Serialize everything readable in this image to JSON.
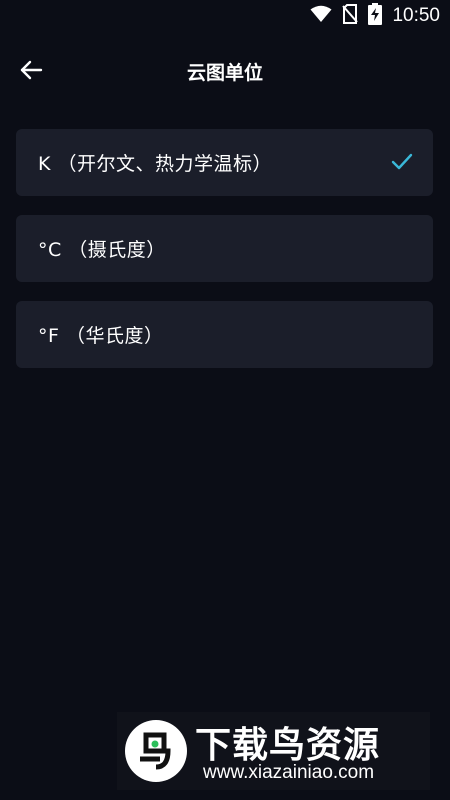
{
  "status_bar": {
    "time": "10:50",
    "icons": [
      "wifi-icon",
      "no-sim-icon",
      "battery-charging-icon"
    ]
  },
  "header": {
    "title": "云图单位",
    "back_icon": "arrow-left-icon"
  },
  "options": [
    {
      "label": "K （开尔文、热力学温标）",
      "selected": true
    },
    {
      "label": "°C （摄氏度）",
      "selected": false
    },
    {
      "label": "°F （华氏度）",
      "selected": false
    }
  ],
  "watermark": {
    "brand": "下载鸟资源",
    "url": "www.xiazainiao.com"
  },
  "colors": {
    "background": "#0b0d16",
    "card": "#1b1e2a",
    "accent": "#3ab8d8",
    "text": "#ffffff"
  }
}
